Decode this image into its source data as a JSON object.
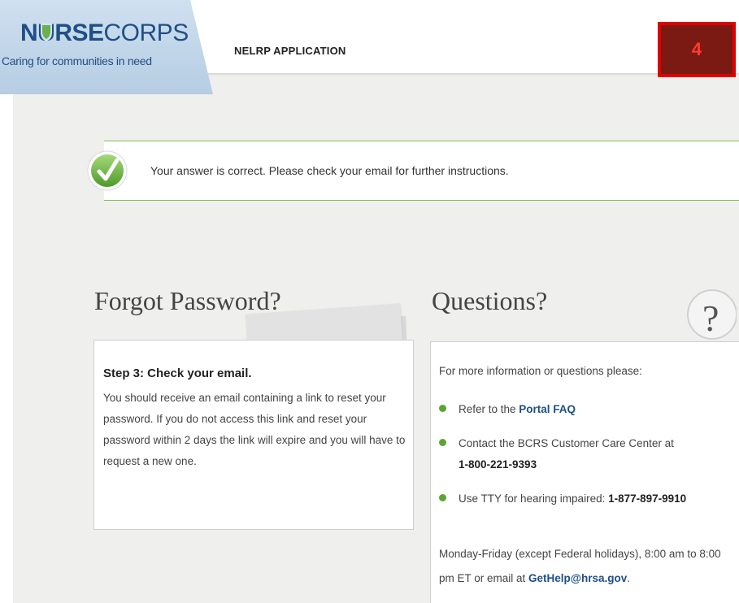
{
  "header": {
    "logo": {
      "nurse": "NURSE",
      "corps": "CORPS",
      "tagline": "Caring for communities in need"
    },
    "app_title": "NELRP APPLICATION",
    "step_badge": "4"
  },
  "banner": {
    "message": "Your answer is correct. Please check your email for further instructions."
  },
  "forgot": {
    "title": "Forgot Password?",
    "step_heading": "Step 3: Check your email.",
    "step_body": "You should receive an email containing a link to reset your password. If you do not access this link and reset your password within 2 days the link will expire and you will have to request a new one."
  },
  "questions": {
    "title": "Questions?",
    "intro": "For more information or questions please:",
    "items": [
      {
        "prefix": "Refer to the ",
        "link": "Portal FAQ"
      },
      {
        "prefix": "Contact the BCRS Customer Care Center at",
        "bold": "1-800-221-9393"
      },
      {
        "prefix": "Use TTY for hearing impaired: ",
        "bold": "1-877-897-9910"
      }
    ],
    "footer_text": "Monday-Friday (except Federal holidays), 8:00 am to 8:00 pm ET or email at ",
    "email_link": "GetHelp@hrsa.gov",
    "footer_end": "."
  },
  "colors": {
    "brand_blue": "#1f4f86",
    "success_green": "#7bc04a",
    "bullet_green": "#5da532",
    "badge_red": "#e00000"
  },
  "icons": {
    "check": "check-circle-icon",
    "question": "question-mark-icon",
    "bullet": "green-dot-icon",
    "logo_shield": "shield-icon"
  }
}
